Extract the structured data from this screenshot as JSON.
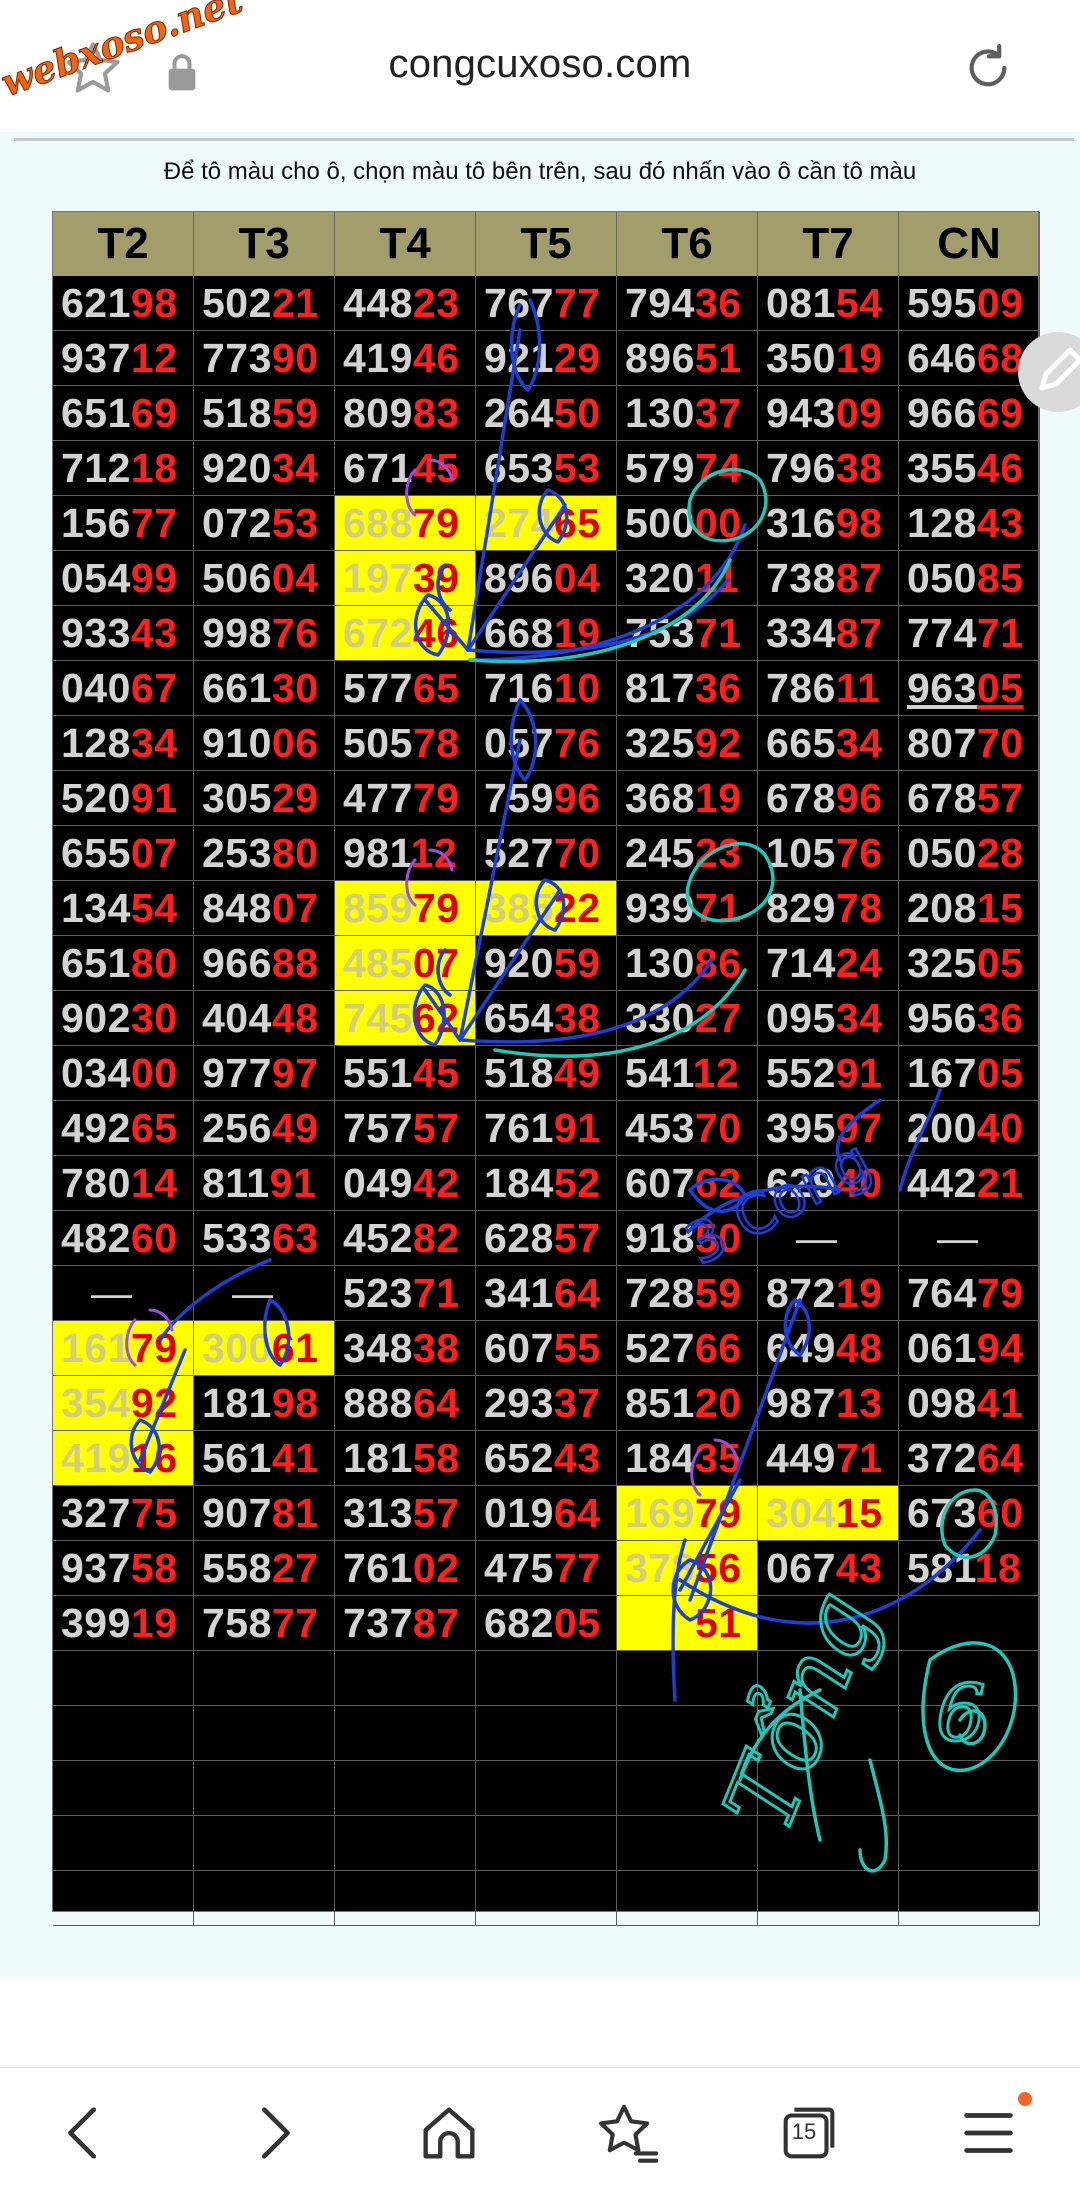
{
  "browser": {
    "url": "congcuxoso.com",
    "watermark": "webxoso.net",
    "icons": [
      "star-icon",
      "lock-icon",
      "reload-icon",
      "edit-icon"
    ]
  },
  "hint": "Để tô màu cho ô, chọn màu tô bên trên, sau đó nhấn vào ô cần tô màu",
  "table": {
    "headers": [
      "T2",
      "T3",
      "T4",
      "T5",
      "T6",
      "T7",
      "CN"
    ],
    "rows": [
      [
        [
          "621",
          "98"
        ],
        [
          "502",
          "21"
        ],
        [
          "448",
          "23"
        ],
        [
          "767",
          "77"
        ],
        [
          "794",
          "36"
        ],
        [
          "081",
          "54"
        ],
        [
          "595",
          "09"
        ]
      ],
      [
        [
          "937",
          "12"
        ],
        [
          "773",
          "90"
        ],
        [
          "419",
          "46"
        ],
        [
          "921",
          "29"
        ],
        [
          "896",
          "51"
        ],
        [
          "350",
          "19"
        ],
        [
          "646",
          "68"
        ]
      ],
      [
        [
          "651",
          "69"
        ],
        [
          "518",
          "59"
        ],
        [
          "809",
          "83"
        ],
        [
          "264",
          "50"
        ],
        [
          "130",
          "37"
        ],
        [
          "943",
          "09"
        ],
        [
          "966",
          "69"
        ]
      ],
      [
        [
          "712",
          "18"
        ],
        [
          "920",
          "34"
        ],
        [
          "671",
          "45"
        ],
        [
          "653",
          "53"
        ],
        [
          "579",
          "74"
        ],
        [
          "796",
          "38"
        ],
        [
          "355",
          "46"
        ]
      ],
      [
        [
          "156",
          "77"
        ],
        [
          "072",
          "53"
        ],
        [
          "688",
          "79"
        ],
        [
          "274",
          "65"
        ],
        [
          "500",
          "00"
        ],
        [
          "316",
          "98"
        ],
        [
          "128",
          "43"
        ]
      ],
      [
        [
          "054",
          "99"
        ],
        [
          "506",
          "04"
        ],
        [
          "197",
          "39"
        ],
        [
          "896",
          "04"
        ],
        [
          "320",
          "11"
        ],
        [
          "738",
          "87"
        ],
        [
          "050",
          "85"
        ]
      ],
      [
        [
          "933",
          "43"
        ],
        [
          "998",
          "76"
        ],
        [
          "672",
          "46"
        ],
        [
          "668",
          "19"
        ],
        [
          "753",
          "71"
        ],
        [
          "334",
          "87"
        ],
        [
          "774",
          "71"
        ]
      ],
      [
        [
          "040",
          "67"
        ],
        [
          "661",
          "30"
        ],
        [
          "577",
          "65"
        ],
        [
          "716",
          "10"
        ],
        [
          "817",
          "36"
        ],
        [
          "786",
          "11"
        ],
        [
          "963",
          "05"
        ]
      ],
      [
        [
          "128",
          "34"
        ],
        [
          "910",
          "06"
        ],
        [
          "505",
          "78"
        ],
        [
          "057",
          "76"
        ],
        [
          "325",
          "92"
        ],
        [
          "665",
          "34"
        ],
        [
          "807",
          "70"
        ]
      ],
      [
        [
          "520",
          "91"
        ],
        [
          "305",
          "29"
        ],
        [
          "477",
          "79"
        ],
        [
          "759",
          "96"
        ],
        [
          "368",
          "19"
        ],
        [
          "678",
          "96"
        ],
        [
          "678",
          "57"
        ]
      ],
      [
        [
          "655",
          "07"
        ],
        [
          "253",
          "80"
        ],
        [
          "981",
          "12"
        ],
        [
          "527",
          "70"
        ],
        [
          "245",
          "23"
        ],
        [
          "105",
          "76"
        ],
        [
          "050",
          "28"
        ]
      ],
      [
        [
          "134",
          "54"
        ],
        [
          "848",
          "07"
        ],
        [
          "859",
          "79"
        ],
        [
          "385",
          "22"
        ],
        [
          "939",
          "71"
        ],
        [
          "829",
          "78"
        ],
        [
          "208",
          "15"
        ]
      ],
      [
        [
          "651",
          "80"
        ],
        [
          "966",
          "88"
        ],
        [
          "485",
          "07"
        ],
        [
          "920",
          "59"
        ],
        [
          "130",
          "86"
        ],
        [
          "714",
          "24"
        ],
        [
          "325",
          "05"
        ]
      ],
      [
        [
          "902",
          "30"
        ],
        [
          "404",
          "48"
        ],
        [
          "745",
          "62"
        ],
        [
          "654",
          "38"
        ],
        [
          "330",
          "27"
        ],
        [
          "095",
          "34"
        ],
        [
          "956",
          "36"
        ]
      ],
      [
        [
          "034",
          "00"
        ],
        [
          "977",
          "97"
        ],
        [
          "551",
          "45"
        ],
        [
          "518",
          "49"
        ],
        [
          "541",
          "12"
        ],
        [
          "552",
          "91"
        ],
        [
          "167",
          "05"
        ]
      ],
      [
        [
          "492",
          "65"
        ],
        [
          "256",
          "49"
        ],
        [
          "757",
          "57"
        ],
        [
          "761",
          "91"
        ],
        [
          "453",
          "70"
        ],
        [
          "395",
          "97"
        ],
        [
          "200",
          "40"
        ]
      ],
      [
        [
          "780",
          "14"
        ],
        [
          "811",
          "91"
        ],
        [
          "049",
          "42"
        ],
        [
          "184",
          "52"
        ],
        [
          "607",
          "62"
        ],
        [
          "629",
          "40"
        ],
        [
          "442",
          "21"
        ]
      ],
      [
        [
          "482",
          "60"
        ],
        [
          "533",
          "63"
        ],
        [
          "452",
          "82"
        ],
        [
          "628",
          "57"
        ],
        [
          "918",
          "50"
        ],
        [
          "—",
          ""
        ],
        [
          "—",
          ""
        ]
      ],
      [
        [
          "—",
          ""
        ],
        [
          "—",
          ""
        ],
        [
          "523",
          "71"
        ],
        [
          "341",
          "64"
        ],
        [
          "728",
          "59"
        ],
        [
          "872",
          "19"
        ],
        [
          "764",
          "79"
        ]
      ],
      [
        [
          "161",
          "79"
        ],
        [
          "300",
          "61"
        ],
        [
          "348",
          "38"
        ],
        [
          "607",
          "55"
        ],
        [
          "527",
          "66"
        ],
        [
          "649",
          "48"
        ],
        [
          "061",
          "94"
        ]
      ],
      [
        [
          "354",
          "92"
        ],
        [
          "181",
          "98"
        ],
        [
          "888",
          "64"
        ],
        [
          "293",
          "37"
        ],
        [
          "851",
          "20"
        ],
        [
          "987",
          "13"
        ],
        [
          "098",
          "41"
        ]
      ],
      [
        [
          "419",
          "16"
        ],
        [
          "561",
          "41"
        ],
        [
          "181",
          "58"
        ],
        [
          "652",
          "43"
        ],
        [
          "184",
          "35"
        ],
        [
          "449",
          "71"
        ],
        [
          "372",
          "64"
        ]
      ],
      [
        [
          "327",
          "75"
        ],
        [
          "907",
          "81"
        ],
        [
          "313",
          "57"
        ],
        [
          "019",
          "64"
        ],
        [
          "169",
          "79"
        ],
        [
          "304",
          "15"
        ],
        [
          "673",
          "60"
        ]
      ],
      [
        [
          "937",
          "58"
        ],
        [
          "558",
          "27"
        ],
        [
          "761",
          "02"
        ],
        [
          "475",
          "77"
        ],
        [
          "378",
          "56"
        ],
        [
          "067",
          "43"
        ],
        [
          "581",
          "18"
        ]
      ],
      [
        [
          "399",
          "19"
        ],
        [
          "758",
          "77"
        ],
        [
          "737",
          "87"
        ],
        [
          "682",
          "05"
        ],
        [
          "",
          "51"
        ],
        [
          "",
          ""
        ],
        [
          "",
          ""
        ]
      ],
      [
        [
          "",
          ""
        ],
        [
          "",
          ""
        ],
        [
          "",
          ""
        ],
        [
          "",
          ""
        ],
        [
          "",
          ""
        ],
        [
          "",
          ""
        ],
        [
          "",
          ""
        ]
      ],
      [
        [
          "",
          ""
        ],
        [
          "",
          ""
        ],
        [
          "",
          ""
        ],
        [
          "",
          ""
        ],
        [
          "",
          ""
        ],
        [
          "",
          ""
        ],
        [
          "",
          ""
        ]
      ],
      [
        [
          "",
          ""
        ],
        [
          "",
          ""
        ],
        [
          "",
          ""
        ],
        [
          "",
          ""
        ],
        [
          "",
          ""
        ],
        [
          "",
          ""
        ],
        [
          "",
          ""
        ]
      ],
      [
        [
          "",
          ""
        ],
        [
          "",
          ""
        ],
        [
          "",
          ""
        ],
        [
          "",
          ""
        ],
        [
          "",
          ""
        ],
        [
          "",
          ""
        ],
        [
          "",
          ""
        ]
      ],
      [
        [
          "",
          ""
        ],
        [
          "",
          ""
        ],
        [
          "",
          ""
        ],
        [
          "",
          ""
        ],
        [
          "",
          ""
        ],
        [
          "",
          ""
        ],
        [
          "",
          ""
        ]
      ]
    ],
    "highlighted": [
      [
        4,
        2
      ],
      [
        5,
        2
      ],
      [
        6,
        2
      ],
      [
        4,
        3
      ],
      [
        11,
        2
      ],
      [
        12,
        2
      ],
      [
        13,
        2
      ],
      [
        11,
        3
      ],
      [
        19,
        0
      ],
      [
        20,
        0
      ],
      [
        21,
        0
      ],
      [
        19,
        1
      ],
      [
        22,
        4
      ],
      [
        23,
        4
      ],
      [
        24,
        4
      ],
      [
        22,
        5
      ]
    ],
    "underlined": [
      [
        7,
        6
      ]
    ]
  },
  "annotations": {
    "handwritten_1": "3 Cong",
    "handwritten_2": "Tổng",
    "handwritten_circle_digit": "6"
  },
  "navbar": {
    "icons": [
      "back-icon",
      "forward-icon",
      "home-icon",
      "bookmarks-icon",
      "tabs-icon",
      "menu-icon"
    ],
    "tabs_count": "15",
    "notification_dot_color": "#f26522"
  },
  "colors": {
    "header_bg": "#a29e6b",
    "table_bg": "#000000",
    "highlight": "#ffff00",
    "suffix_red": "#ff1f1f",
    "prefix_gray": "#d3d3d3",
    "ink_blue": "#1c3fd6",
    "ink_cyan": "#21c7b6",
    "ink_purple": "#9a4fe0"
  }
}
